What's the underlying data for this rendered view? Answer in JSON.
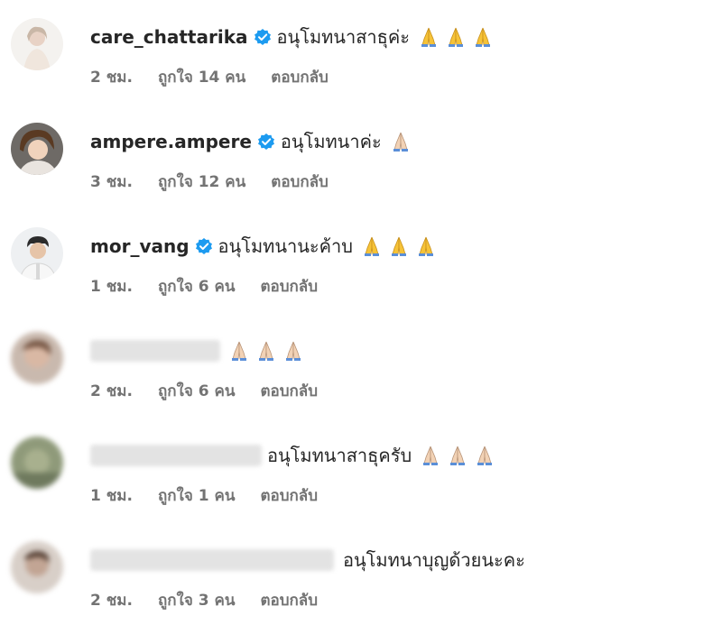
{
  "comments": [
    {
      "username": "care_chattarika",
      "verified": true,
      "text": "อนุโมทนาสาธุค่ะ",
      "emoji_count": 3,
      "emoji_tone": "yellow",
      "time": "2 ชม.",
      "likes": "ถูกใจ 14 คน",
      "reply": "ตอบกลับ"
    },
    {
      "username": "ampere.ampere",
      "verified": true,
      "text": "อนุโมทนาค่ะ",
      "emoji_count": 1,
      "emoji_tone": "light",
      "time": "3 ชม.",
      "likes": "ถูกใจ 12 คน",
      "reply": "ตอบกลับ"
    },
    {
      "username": "mor_vang",
      "verified": true,
      "text": "อนุโมทนานะค้าบ",
      "emoji_count": 3,
      "emoji_tone": "yellow",
      "time": "1 ชม.",
      "likes": "ถูกใจ 6 คน",
      "reply": "ตอบกลับ"
    },
    {
      "username": "",
      "verified": false,
      "text": "",
      "emoji_count": 3,
      "emoji_tone": "light",
      "time": "2 ชม.",
      "likes": "ถูกใจ 6 คน",
      "reply": "ตอบกลับ"
    },
    {
      "username": "",
      "verified": false,
      "text": "อนุโมทนาสาธุครับ",
      "emoji_count": 3,
      "emoji_tone": "light",
      "time": "1 ชม.",
      "likes": "ถูกใจ 1 คน",
      "reply": "ตอบกลับ"
    },
    {
      "username": "",
      "verified": false,
      "text": "อนุโมทนาบุญด้วยนะคะ",
      "emoji_count": 0,
      "emoji_tone": "",
      "time": "2 ชม.",
      "likes": "ถูกใจ 3 คน",
      "reply": "ตอบกลับ"
    }
  ],
  "icons": {
    "verified": "verified-badge-icon",
    "emoji": "folded-hands-emoji"
  },
  "colors": {
    "verified": "#1d9bf0",
    "meta_text": "#737373",
    "emoji_yellow": "#f6c338",
    "emoji_light": "#f2d2b5",
    "emoji_blue_cuff": "#5b8fd8"
  }
}
